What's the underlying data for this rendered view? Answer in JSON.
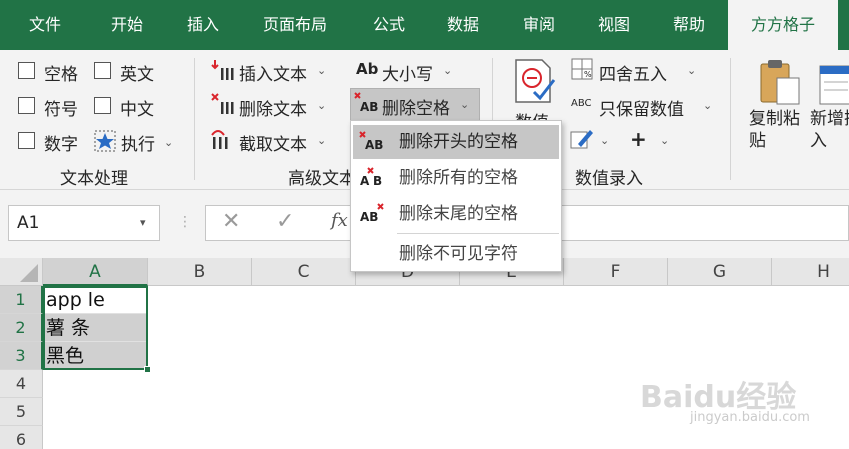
{
  "menu": {
    "tabs": [
      "文件",
      "开始",
      "插入",
      "页面布局",
      "公式",
      "数据",
      "审阅",
      "视图",
      "帮助",
      "方方格子"
    ],
    "active": "方方格子"
  },
  "ribbon": {
    "text_group": {
      "label": "文本处理",
      "checkboxes": [
        "空格",
        "英文",
        "符号",
        "中文",
        "数字"
      ],
      "execute": "执行"
    },
    "advanced_group": {
      "label": "高级文本",
      "insert_text": "插入文本",
      "delete_text": "删除文本",
      "extract_text": "截取文本",
      "case": "大小写",
      "delete_space": "删除空格"
    },
    "number_group": {
      "label": "数值录入",
      "value_button": "数值",
      "round": "四舍五入",
      "keep_values": "只保留数值"
    },
    "copy_paste": "复制粘贴",
    "new_insert": "新增插入"
  },
  "formula_bar": {
    "name_box": "A1",
    "fx": "fx"
  },
  "dropdown": {
    "items": [
      "删除开头的空格",
      "删除所有的空格",
      "删除末尾的空格",
      "删除不可见字符"
    ]
  },
  "grid": {
    "columns": [
      "A",
      "B",
      "C",
      "D",
      "E",
      "F",
      "G",
      "H"
    ],
    "rows": [
      "1",
      "2",
      "3",
      "4",
      "5",
      "6"
    ],
    "cells": {
      "A1": "app le",
      "A2": "薯 条",
      "A3": "黑色"
    }
  },
  "watermark": {
    "brand": "Baidu经验",
    "url": "jingyan.baidu.com"
  },
  "colors": {
    "excel_green": "#217346",
    "ribbon_bg": "#f3f3f3",
    "selection_fill": "#d0d0d0",
    "icon_red": "#d9252c"
  }
}
